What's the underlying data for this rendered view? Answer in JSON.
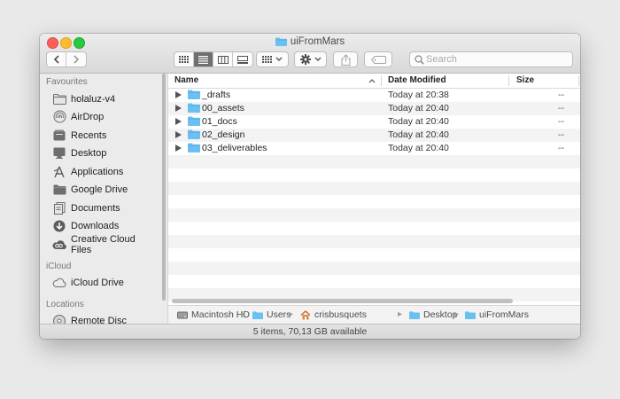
{
  "window": {
    "title": "uiFromMars"
  },
  "toolbar": {
    "search_placeholder": "Search"
  },
  "sidebar": {
    "favourites_header": "Favourites",
    "favourites": [
      {
        "label": "holaluz-v4",
        "icon": "folder-icon"
      },
      {
        "label": "AirDrop",
        "icon": "airdrop-icon"
      },
      {
        "label": "Recents",
        "icon": "recents-icon"
      },
      {
        "label": "Desktop",
        "icon": "desktop-icon"
      },
      {
        "label": "Applications",
        "icon": "applications-icon"
      },
      {
        "label": "Google Drive",
        "icon": "folder-icon"
      },
      {
        "label": "Documents",
        "icon": "documents-icon"
      },
      {
        "label": "Downloads",
        "icon": "downloads-icon"
      },
      {
        "label": "Creative Cloud Files",
        "icon": "creative-cloud-icon"
      }
    ],
    "icloud_header": "iCloud",
    "icloud": [
      {
        "label": "iCloud Drive",
        "icon": "cloud-icon"
      }
    ],
    "locations_header": "Locations",
    "locations": [
      {
        "label": "Remote Disc",
        "icon": "disc-icon"
      }
    ]
  },
  "columns": {
    "name": "Name",
    "date": "Date Modified",
    "size": "Size"
  },
  "files": [
    {
      "name": "_drafts",
      "date": "Today at 20:38",
      "size": "--"
    },
    {
      "name": "00_assets",
      "date": "Today at 20:40",
      "size": "--"
    },
    {
      "name": "01_docs",
      "date": "Today at 20:40",
      "size": "--"
    },
    {
      "name": "02_design",
      "date": "Today at 20:40",
      "size": "--"
    },
    {
      "name": "03_deliverables",
      "date": "Today at 20:40",
      "size": "--"
    }
  ],
  "pathbar": [
    "Macintosh HD",
    "Users",
    "crisbusquets",
    "Desktop",
    "uiFromMars"
  ],
  "status": "5 items, 70,13 GB available",
  "colors": {
    "folder": "#6cc0f1",
    "folder_dark": "#4aa6de",
    "sidebar_bg": "#ebebeb",
    "active_view": "#6f6f6f"
  }
}
